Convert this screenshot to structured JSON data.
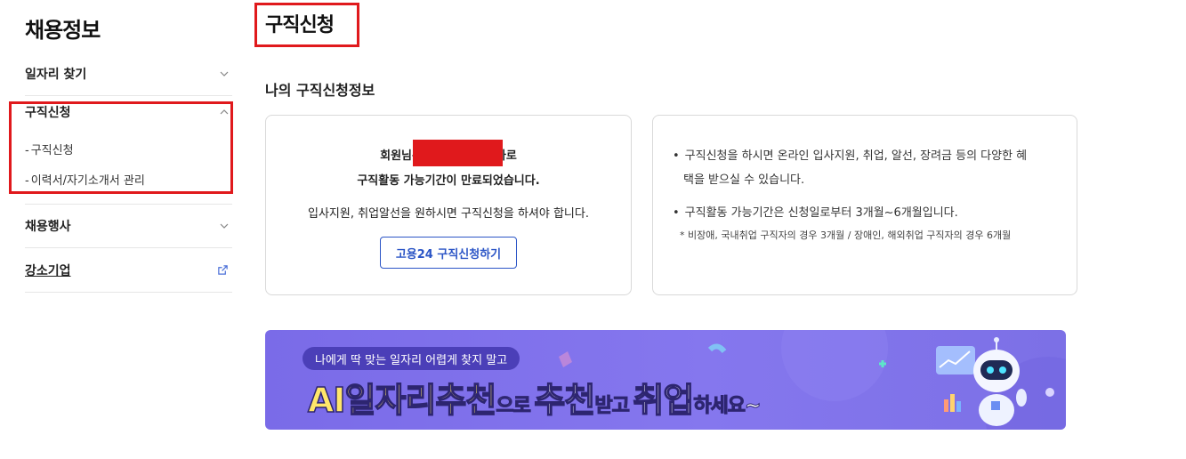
{
  "sidebar": {
    "title": "채용정보",
    "items": [
      {
        "label": "일자리 찾기",
        "expanded": false
      },
      {
        "label": "구직신청",
        "expanded": true,
        "children": [
          "구직신청",
          "이력서/자기소개서 관리"
        ]
      },
      {
        "label": "채용행사",
        "expanded": false
      },
      {
        "label": "강소기업",
        "external": true
      }
    ]
  },
  "main": {
    "page_title": "구직신청",
    "section_title": "나의 구직신청정보",
    "left_card": {
      "line1_prefix": "회원님은",
      "line1_suffix": "자로",
      "line2": "구직활동 가능기간이 만료되었습니다.",
      "line3": "입사지원, 취업알선을 원하시면 구직신청을 하셔야 합니다.",
      "button_label": "고용24 구직신청하기"
    },
    "right_card": {
      "bullet1_line1": "구직신청을 하시면 온라인 입사지원, 취업, 알선, 장려금 등의 다양한 혜",
      "bullet1_line2": "택을 받으실 수 있습니다.",
      "bullet2": "구직활동 가능기간은 신청일로부터 3개월~6개월입니다.",
      "note": "* 비장애, 국내취업 구직자의 경우 3개월 / 장애인, 해외취업 구직자의 경우 6개월"
    },
    "banner": {
      "pill_text": "나에게 딱 맞는 일자리 어렵게 찾지 말고",
      "head_ai": "AI일자리추천",
      "head_part2": "으로",
      "head_part3": "추천",
      "head_part4": "받고",
      "head_part5": "취업",
      "head_part6": "하세요~"
    }
  },
  "colors": {
    "highlight": "#e0191c",
    "accent_blue": "#2b55c6",
    "banner_purple": "#7a6be8",
    "banner_yellow": "#ffe66a"
  },
  "icons": {
    "chevron": "chevron-down-icon",
    "chevron_up": "chevron-up-icon",
    "external": "external-link-icon"
  }
}
